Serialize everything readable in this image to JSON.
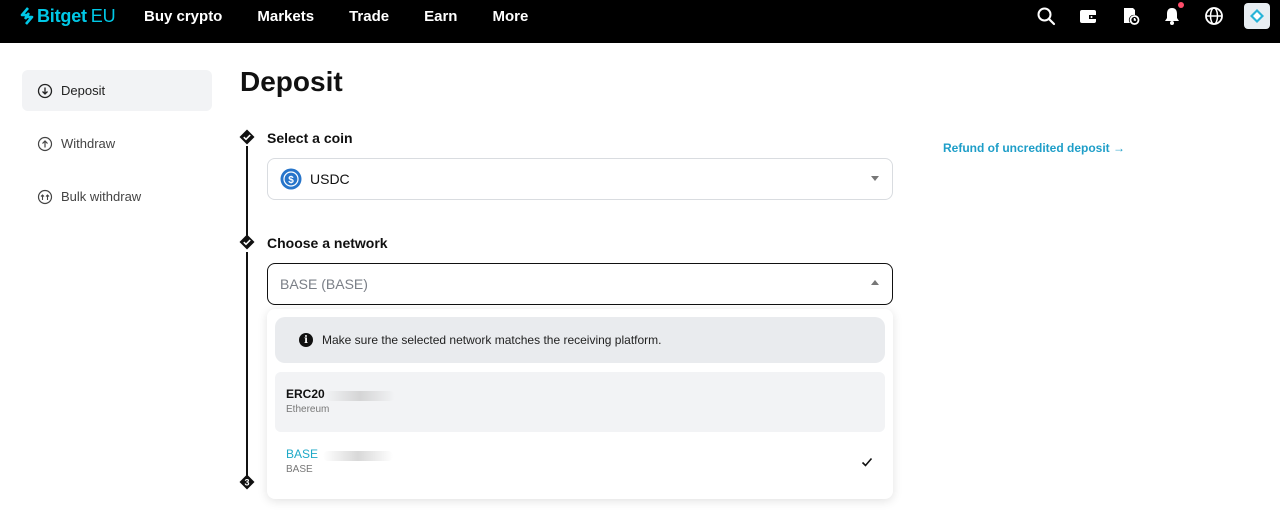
{
  "brand": {
    "name": "Bitget",
    "region": "EU",
    "accent": "#00c8e6"
  },
  "nav": {
    "links": [
      "Buy crypto",
      "Markets",
      "Trade",
      "Earn",
      "More"
    ],
    "icons": [
      "search-icon",
      "wallet-icon",
      "orders-icon",
      "bell-icon",
      "globe-icon",
      "avatar"
    ]
  },
  "sidebar": {
    "items": [
      {
        "label": "Deposit",
        "icon": "arrow-down-circle-icon",
        "active": true
      },
      {
        "label": "Withdraw",
        "icon": "arrow-up-circle-icon",
        "active": false
      },
      {
        "label": "Bulk withdraw",
        "icon": "bulk-arrows-circle-icon",
        "active": false
      }
    ]
  },
  "page": {
    "title": "Deposit"
  },
  "steps": {
    "coin": {
      "label": "Select a coin",
      "value": "USDC"
    },
    "network": {
      "label": "Choose a network",
      "value": "BASE (BASE)"
    },
    "third": {
      "marker": "3"
    }
  },
  "refund_link": "Refund of uncredited deposit",
  "dropdown": {
    "notice": "Make sure the selected network matches the receiving platform.",
    "options": [
      {
        "name": "ERC20",
        "sub": "Ethereum",
        "selected": false
      },
      {
        "name": "BASE",
        "sub": "BASE",
        "selected": true
      }
    ]
  },
  "colors": {
    "link": "#1e9ec8",
    "selected": "#1ea9c7",
    "usdc": "#2775ca"
  }
}
